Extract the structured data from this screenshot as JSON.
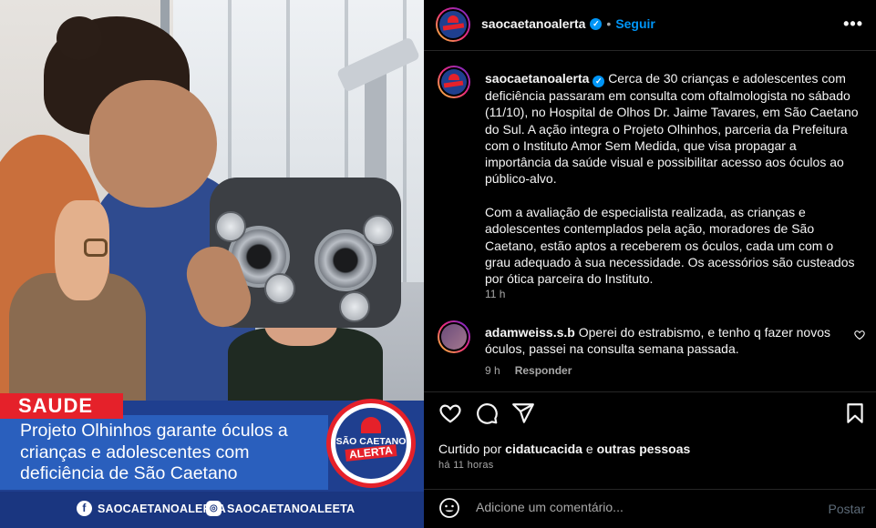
{
  "media": {
    "tag": "SAUDE",
    "headline": "Projeto Olhinhos garante óculos a crianças e adolescentes com deficiência de São Caetano",
    "facebook_handle": "SAOCAETANOALERTA",
    "instagram_handle": "SAOCAETANOALEETA",
    "logo_line1": "SÃO CAETANO",
    "logo_line2": "ALERTA"
  },
  "header": {
    "username": "saocaetanoalerta",
    "separator": "•",
    "follow_label": "Seguir",
    "more_label": "•••"
  },
  "caption": {
    "username": "saocaetanoalerta",
    "paragraph1": "Cerca de 30 crianças e adolescentes com deficiência passaram em consulta com oftalmologista no sábado (11/10), no Hospital de Olhos Dr. Jaime Tavares, em São Caetano do Sul. A ação integra o Projeto Olhinhos, parceria da Prefeitura com o Instituto Amor Sem Medida, que visa propagar a importância da saúde visual e possibilitar acesso aos óculos ao público-alvo.",
    "paragraph2": "Com a avaliação de especialista realizada, as crianças e adolescentes contemplados pela ação, moradores de São Caetano, estão aptos a receberem os óculos, cada um com o grau adequado à sua necessidade. Os acessórios são custeados por ótica parceira do Instituto.",
    "time": "11 h"
  },
  "comment": {
    "username": "adamweiss.s.b",
    "text": "Operei do estrabismo, e tenho q fazer novos óculos, passei na consulta semana passada.",
    "time": "9 h",
    "reply_label": "Responder"
  },
  "likes": {
    "prefix": "Curtido por",
    "user": "cidatucacida",
    "connector": "e",
    "others": "outras pessoas"
  },
  "post_time": "há 11 horas",
  "add_comment": {
    "placeholder": "Adicione um comentário...",
    "post_label": "Postar"
  },
  "colors": {
    "accent_blue": "#0095f6",
    "brand_red": "#e5212a",
    "brand_blue": "#1f3f8f"
  }
}
